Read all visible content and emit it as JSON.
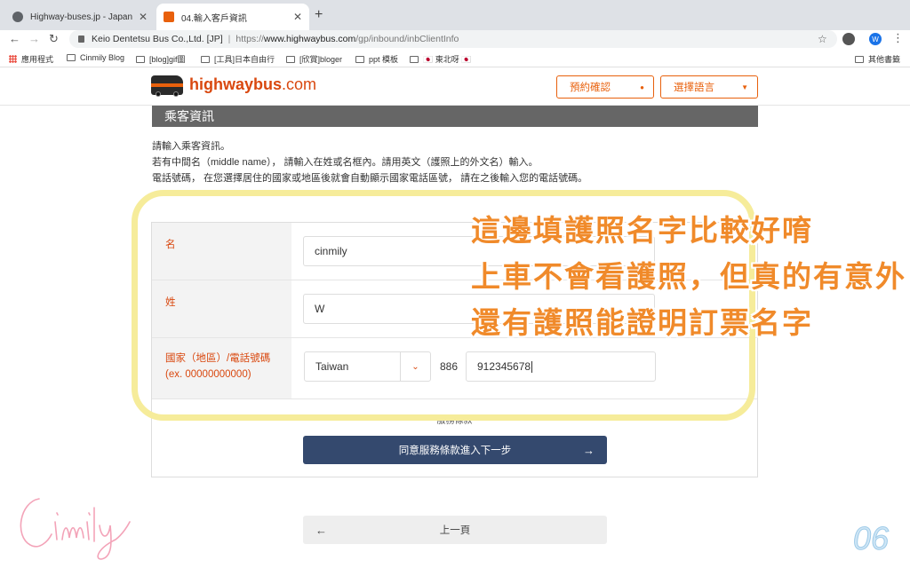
{
  "browser": {
    "tabs": [
      {
        "title": "Highway-buses.jp - Japan",
        "active": false
      },
      {
        "title": "04.輸入客戶資訊",
        "active": true
      }
    ],
    "new_tab": "+",
    "close": "✕",
    "address": {
      "site_name": "Keio Dentetsu Bus Co.,Ltd. [JP]",
      "separator": "|",
      "url_scheme": "https://",
      "url_host": "www.highwaybus.com",
      "url_path": "/gp/inbound/inbClientInfo"
    },
    "profile_initial": "W",
    "bookmarks": [
      {
        "label": "應用程式",
        "icon": "apps-grid-icon"
      },
      {
        "label": "Cinmily Blog",
        "icon": "folder-icon"
      },
      {
        "label": "[blog]gif圖",
        "icon": "folder-icon"
      },
      {
        "label": "[工具]日本自由行",
        "icon": "folder-icon"
      },
      {
        "label": "[欣賞]bloger",
        "icon": "folder-icon"
      },
      {
        "label": "ppt 模板",
        "icon": "folder-icon"
      },
      {
        "label": "🇯🇵 東北呀 🇯🇵",
        "icon": "folder-icon"
      },
      {
        "label": "其他書籤",
        "icon": "folder-icon"
      }
    ]
  },
  "header": {
    "logo_main": "highwaybus",
    "logo_suffix": ".com",
    "booking_button": "預約確認",
    "language_button": "選擇語言"
  },
  "section": {
    "title": "乘客資訊",
    "instructions": [
      "請輸入乘客資訊。",
      "若有中間名（middle name）， 請輸入在姓或名框內。請用英文（護照上的外文名）輸入。",
      "電話號碼， 在您選擇居住的國家或地區後就會自動顯示國家電話區號， 請在之後輸入您的電話號碼。"
    ]
  },
  "form": {
    "first_name_label": "名",
    "first_name_value": "cinmily",
    "last_name_label": "姓",
    "last_name_value": "W",
    "country_label_1": "國家（地區）/電話號碼",
    "country_label_2": "(ex. 00000000000)",
    "country_selected": "Taiwan",
    "dial_code": "886",
    "phone_value": "912345678",
    "terms_link": "服務條款"
  },
  "buttons": {
    "next": "同意服務條款進入下一步",
    "back": "上一頁"
  },
  "annotation": {
    "lines": [
      "這邊填護照名字比較好唷",
      "上車不會看護照，但真的有意外",
      "還有護照能證明訂票名字"
    ]
  },
  "page_number": "06",
  "signature": "Cinmily",
  "colors": {
    "accent": "#e8600c",
    "label_red": "#d9480f",
    "primary_button": "#34496e",
    "highlight": "#f6ec9a",
    "annotation": "#f08a2a"
  }
}
